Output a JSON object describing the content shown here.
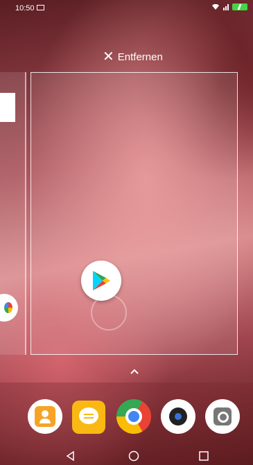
{
  "status_bar": {
    "time": "10:50"
  },
  "recents": {
    "remove_label": "Entfernen",
    "close_icon": "close-icon",
    "main_card_app": "google-play-store",
    "left_card_app": "photos-app",
    "expand_icon": "chevron-up-icon"
  },
  "dock": {
    "apps": [
      "contacts",
      "messages",
      "chrome",
      "camera",
      "settings"
    ]
  },
  "navigation": {
    "buttons": [
      "back",
      "home",
      "recent-apps"
    ]
  },
  "colors": {
    "battery": "#44d444",
    "messages_yellow": "#f9b912",
    "contacts_orange": "#f6a326"
  }
}
